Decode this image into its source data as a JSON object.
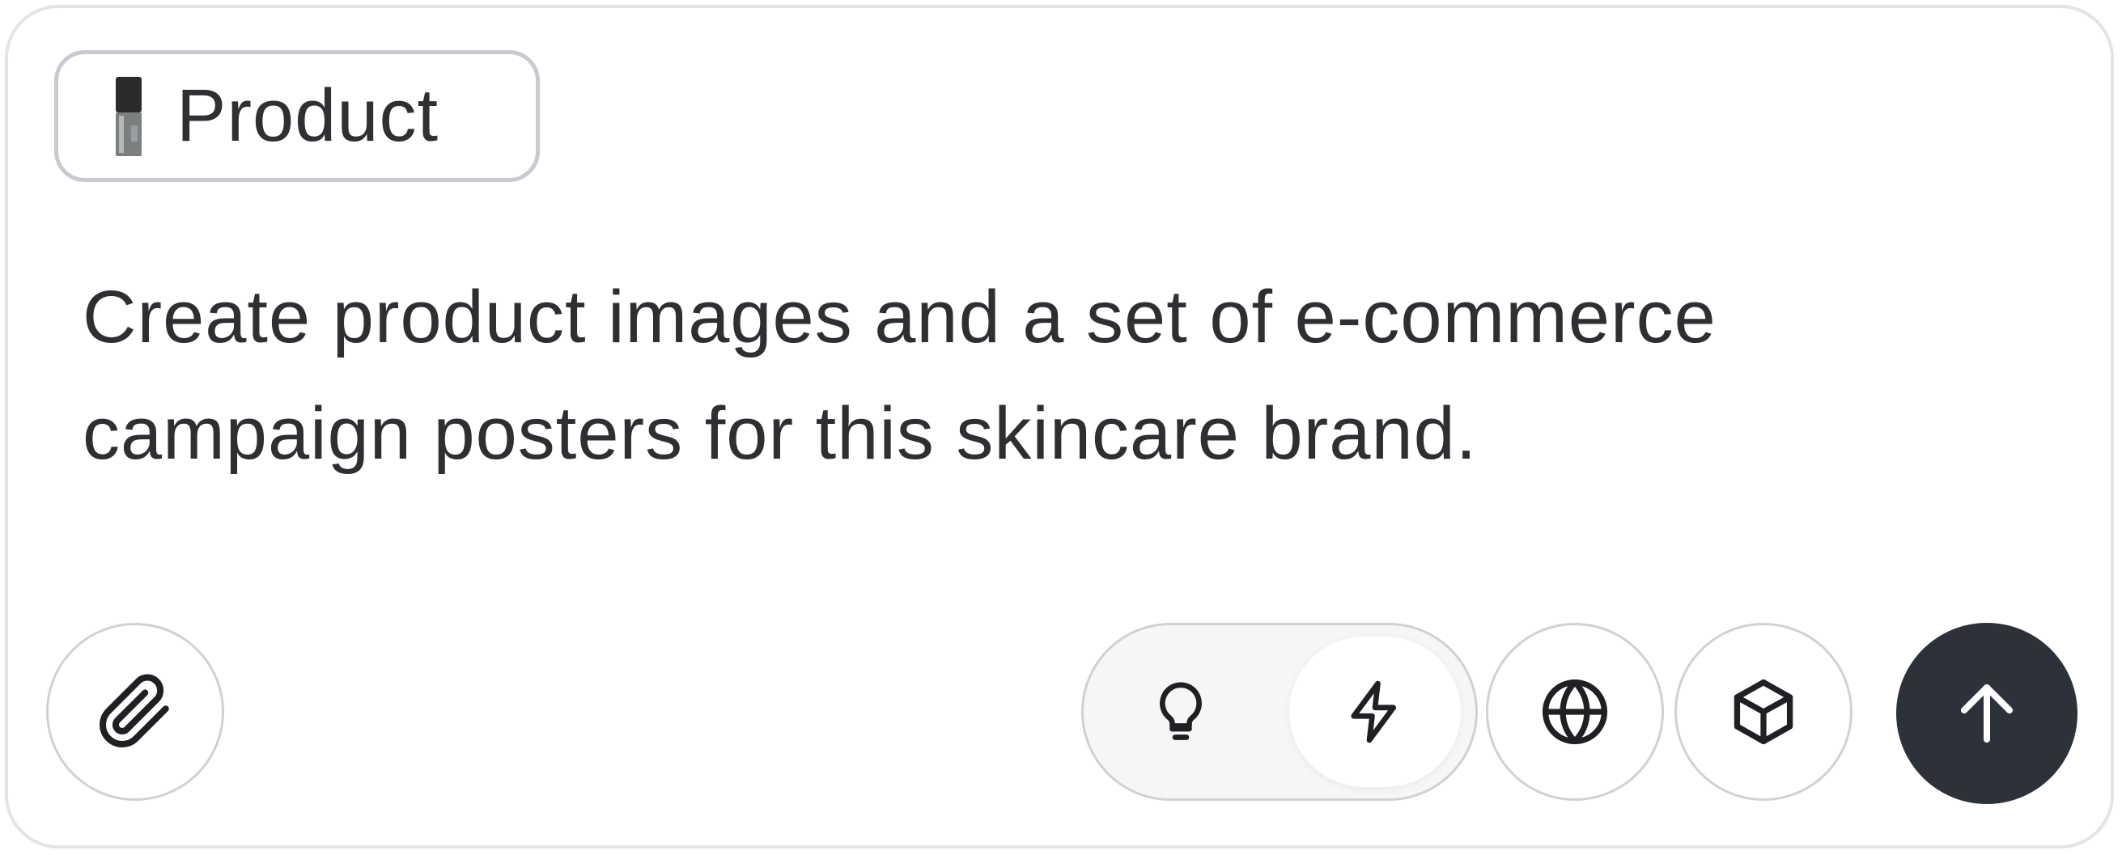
{
  "composer": {
    "attachment_chip": {
      "label": "Product",
      "thumbnail_icon": "serum-bottle-thumbnail"
    },
    "prompt_text": "Create product images and a set of e-commerce campaign posters for this skincare brand.",
    "toolbar": {
      "attach_icon": "paperclip-icon",
      "mode_toggle": {
        "options": [
          "lightbulb-icon",
          "lightning-icon"
        ],
        "selected": "lightning-icon"
      },
      "web_icon": "globe-icon",
      "model_icon": "cube-icon",
      "send_icon": "arrow-up-icon"
    }
  },
  "colors": {
    "text": "#2e2f33",
    "border": "#cfd1d6",
    "send_button": "#2d313a",
    "toggle_track": "#f6f6f7"
  }
}
